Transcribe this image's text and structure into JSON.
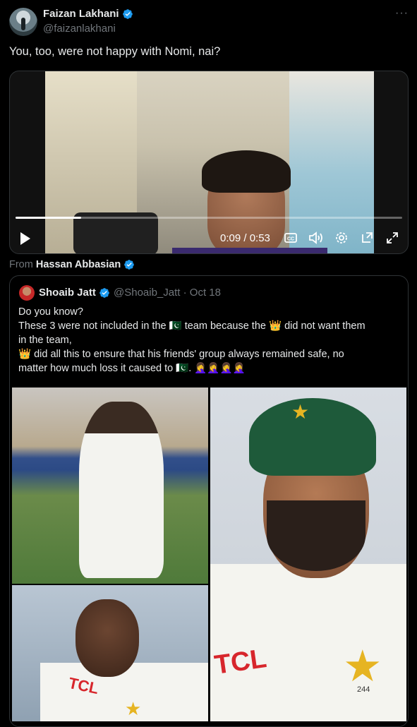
{
  "post": {
    "author_name": "Faizan Lakhani",
    "author_handle": "@faizanlakhani",
    "text": "You, too, were not happy with Nomi, nai?",
    "more_icon": "more-horizontal-icon"
  },
  "video": {
    "time": "0:09 / 0:53",
    "progress": 0.17
  },
  "from": {
    "label": "From",
    "name": "Hassan Abbasian"
  },
  "quote": {
    "author_name": "Shoaib Jatt",
    "author_handle": "@Shoaib_Jatt",
    "date": "· Oct 18",
    "line1": "Do you know?",
    "line2": "These 3 were not included in the 🇵🇰 team because the 👑 did not want them",
    "line3": "in the team,",
    "line4": "👑 did all this to ensure that his friends' group always remained safe, no",
    "line5": "matter how much loss it caused to 🇵🇰. 🤦‍♀️🤦‍♀️🤦‍♀️🤦‍♀️"
  },
  "photos": {
    "jersey_text_left": "TCL",
    "jersey_text_right": "TCL",
    "shirt_number": "244"
  },
  "colors": {
    "background": "#000000",
    "text": "#e7e9ea",
    "muted": "#71767b",
    "verified": "#1d9bf0",
    "border": "#2f3336"
  }
}
